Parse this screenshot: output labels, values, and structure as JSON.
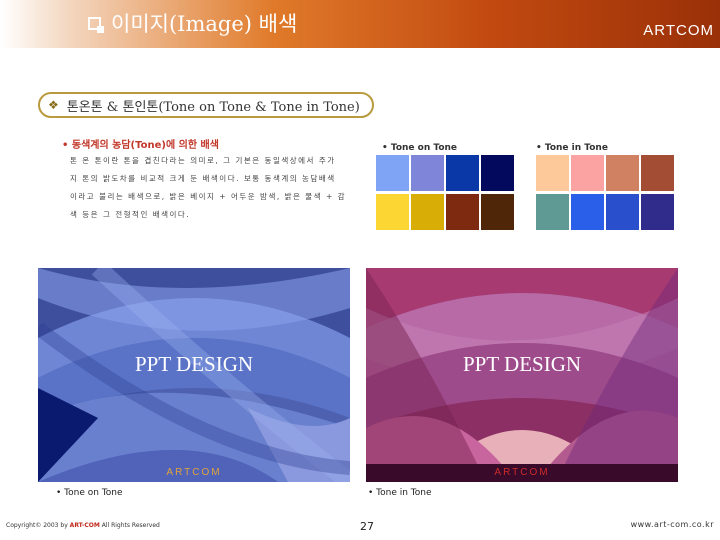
{
  "header": {
    "title": "이미지(Image) 배색",
    "brand": "ARTCOM"
  },
  "section": {
    "title": "톤온톤 & 톤인톤(Tone on Tone & Tone in Tone)"
  },
  "intro": {
    "subtitle": "• 동색계의 농담(Tone)에 의한 배색",
    "lines": [
      "톤 온 톤이란 톤을 겹친다라는 의미로, 그 기본은 동일색상에서 주가",
      "지 톤의 밝도차를 비교적 크게 둔 배색이다. 보통 동색계의 농담배색",
      "이라고 불리는 배색으로, 밝은 베이지 + 어두운 밤색, 밝은 물색 + 감",
      "색 등은 그 전형적인 배색이다."
    ]
  },
  "palettes": {
    "tone_on_tone": {
      "label": "• Tone on Tone",
      "row1": [
        "#7fa3f5",
        "#7f86d9",
        "#0a38a6",
        "#030a5e"
      ],
      "row2": [
        "#fcd733",
        "#d8ad05",
        "#7e2a10",
        "#4f2607"
      ]
    },
    "tone_in_tone": {
      "label": "• Tone in Tone",
      "row1": [
        "#fdc89a",
        "#fba3a3",
        "#cf8161",
        "#a34e34"
      ],
      "row2": [
        "#5f9a95",
        "#2a5fe9",
        "#2a4fcd",
        "#2f2c8c"
      ]
    }
  },
  "designs": {
    "left": {
      "text": "PPT DESIGN",
      "brand": "ARTCOM",
      "caption": "• Tone on Tone",
      "brand_color": "#e0a23a"
    },
    "right": {
      "text": "PPT DESIGN",
      "brand": "ARTCOM",
      "caption": "• Tone in Tone",
      "brand_color": "#cc2a2a"
    }
  },
  "footer": {
    "copyright_pre": "Copyright© 2003 by ",
    "copyright_brand": "ART-COM",
    "copyright_post": " All Rights Reserved",
    "page": "27",
    "url": "www.art-com.co.kr"
  }
}
